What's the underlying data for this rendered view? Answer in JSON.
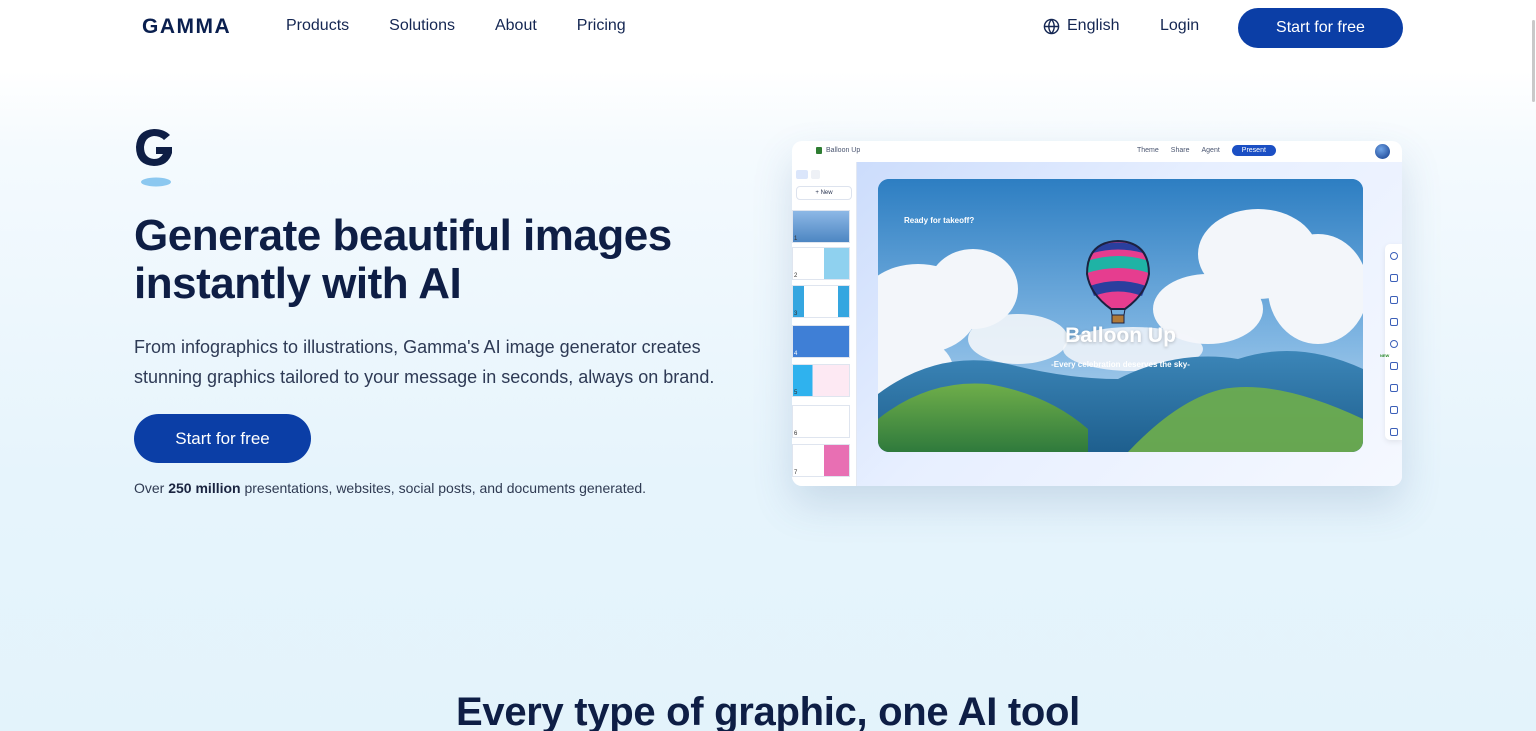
{
  "nav": {
    "logo": "GAMMA",
    "links": [
      "Products",
      "Solutions",
      "About",
      "Pricing"
    ],
    "language": "English",
    "login": "Login",
    "cta": "Start for free"
  },
  "hero": {
    "title_line1": "Generate beautiful images",
    "title_line2": "instantly with AI",
    "description_line1": "From infographics to illustrations, Gamma's AI image generator creates",
    "description_line2": "stunning graphics tailored to your message in seconds, always on brand.",
    "cta": "Start for free",
    "stat_prefix": "Over ",
    "stat_bold": "250 million",
    "stat_suffix": " presentations, websites, social posts, and documents generated."
  },
  "app": {
    "doc_title": "Balloon Up",
    "actions": [
      "Theme",
      "Share",
      "Agent"
    ],
    "present": "Present",
    "new_button": "+ New",
    "slide_numbers": [
      "1",
      "2",
      "3",
      "4",
      "5",
      "6",
      "7"
    ],
    "toolbar_badge": "NEW",
    "slide": {
      "kicker": "Ready for takeoff?",
      "title": "Balloon Up",
      "subtitle": "-Every celebration deserves the sky-"
    }
  },
  "section": {
    "title": "Every type of graphic, one AI tool"
  },
  "colors": {
    "brand": "#0b3ea6",
    "text": "#0e1e45",
    "accent_blue": "#1b4fc4"
  }
}
